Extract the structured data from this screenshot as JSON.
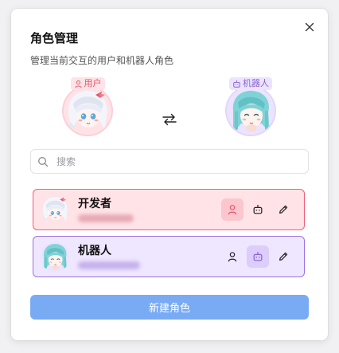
{
  "dialog": {
    "title": "角色管理",
    "subtitle": "管理当前交互的用户和机器人角色"
  },
  "current": {
    "user_chip": "用户",
    "bot_chip": "机器人",
    "user_chip_icon": "person-icon",
    "bot_chip_icon": "robot-icon",
    "swap_icon": "swap-arrows-icon"
  },
  "search": {
    "placeholder": "搜索"
  },
  "roles": [
    {
      "name": "开发者",
      "selected_as": "user",
      "accent": "#ef5f78",
      "background": "#ffe3e7"
    },
    {
      "name": "机器人",
      "selected_as": "bot",
      "accent": "#9a73dd",
      "background": "#efe6ff"
    }
  ],
  "actions": {
    "set_user_icon": "person-icon",
    "set_bot_icon": "robot-icon",
    "edit_icon": "pencil-icon"
  },
  "footer": {
    "new_role_label": "新建角色"
  },
  "colors": {
    "user_accent": "#e2556b",
    "bot_accent": "#8a63d2",
    "primary_button": "#79abf4"
  }
}
